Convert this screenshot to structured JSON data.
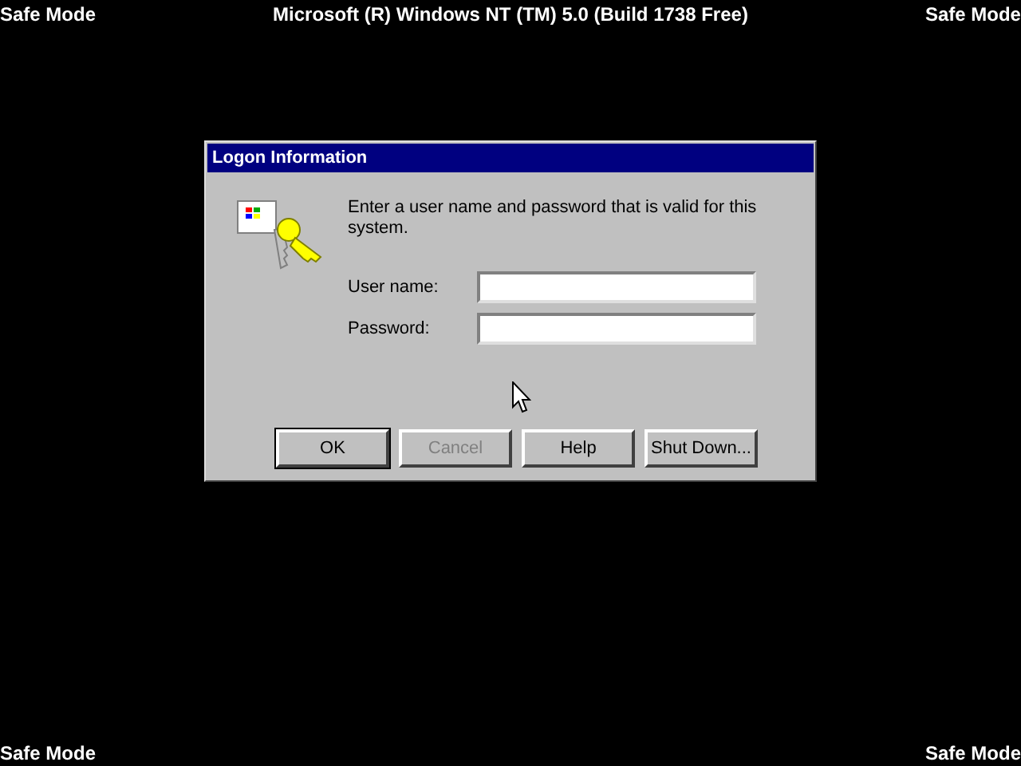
{
  "screen": {
    "corner_labels": [
      "Safe Mode",
      "Safe Mode",
      "Safe Mode",
      "Safe Mode"
    ],
    "banner": "Microsoft (R) Windows NT (TM) 5.0 (Build 1738 Free)"
  },
  "dialog": {
    "title": "Logon Information",
    "message": "Enter a user name and password that is valid for this system.",
    "fields": [
      {
        "label": "User name:"
      },
      {
        "label": "Password:"
      }
    ],
    "buttons": [
      {
        "label": "OK",
        "default": true,
        "disabled": false
      },
      {
        "label": "Cancel",
        "default": false,
        "disabled": true
      },
      {
        "label": "Help",
        "default": false,
        "disabled": false
      },
      {
        "label": "Shut Down...",
        "default": false,
        "disabled": false
      }
    ]
  }
}
